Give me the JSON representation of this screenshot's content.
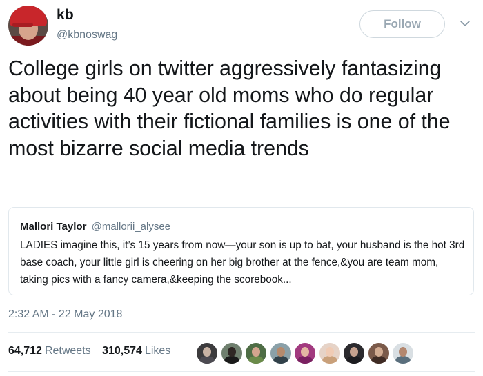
{
  "author": {
    "display_name": "kb",
    "handle": "@kbnoswag",
    "avatar_icon": "profile-photo-icon"
  },
  "follow_button": {
    "label": "Follow"
  },
  "menu_icon": "chevron-down-icon",
  "tweet": {
    "text": "College girls on twitter aggressively fantasizing about being 40 year old moms who do regular activities with their fictional families is one of the most bizarre social media trends",
    "timestamp": "2:32 AM - 22 May 2018"
  },
  "quoted_tweet": {
    "author_name": "Mallori Taylor",
    "author_handle": "@mallorii_alysee",
    "text": "LADIES imagine this, it’s 15 years from now—your son is up to bat, your husband is the hot 3rd base coach, your little girl is cheering on her big brother at the fence,&you are team mom, taking pics with a fancy camera,&keeping the scorebook..."
  },
  "stats": {
    "retweets_count": "64,712",
    "retweets_label": "Retweets",
    "likes_count": "310,574",
    "likes_label": "Likes"
  },
  "likers": [
    {
      "name": "liker-avatar-1",
      "bg": "#3c3b3d",
      "skin": "#c9b3a4",
      "shirt": "#4d4b52"
    },
    {
      "name": "liker-avatar-2",
      "bg": "#6f7f6e",
      "skin": "#2f2724",
      "shirt": "#1a1a1a"
    },
    {
      "name": "liker-avatar-3",
      "bg": "#4e6d45",
      "skin": "#d3a58e",
      "shirt": "#6b8b4a"
    },
    {
      "name": "liker-avatar-4",
      "bg": "#8aa0a8",
      "skin": "#b58a6d",
      "shirt": "#31414a"
    },
    {
      "name": "liker-avatar-5",
      "bg": "#a23a7f",
      "skin": "#e3b8a3",
      "shirt": "#7a2161"
    },
    {
      "name": "liker-avatar-6",
      "bg": "#e6d3c7",
      "skin": "#f0cbb4",
      "shirt": "#c9a07a"
    },
    {
      "name": "liker-avatar-7",
      "bg": "#2b2a2e",
      "skin": "#c7a28f",
      "shirt": "#1d1c20"
    },
    {
      "name": "liker-avatar-8",
      "bg": "#7b5a4a",
      "skin": "#d2ab91",
      "shirt": "#3f2b24"
    },
    {
      "name": "liker-avatar-9",
      "bg": "#d9dfe3",
      "skin": "#b3876f",
      "shirt": "#5a6f7d"
    }
  ],
  "colors": {
    "text_primary": "#14171a",
    "text_secondary": "#657786",
    "border": "#e1e8ed",
    "follow_text": "#9aa8b3"
  }
}
